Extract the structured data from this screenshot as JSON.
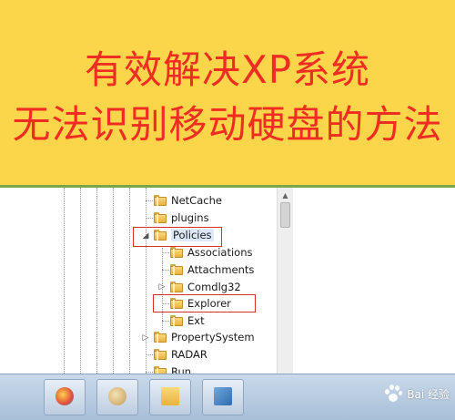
{
  "banner": {
    "line1": "有效解决XP系统",
    "line2": "无法识别移动硬盘的方法",
    "background": "#fbd54a",
    "text_color": "#ef2d23"
  },
  "tree": {
    "items": [
      {
        "label": "NetCache",
        "expander": "none",
        "icon": "folder-icon"
      },
      {
        "label": "plugins",
        "expander": "none",
        "icon": "folder-icon"
      },
      {
        "label": "Policies",
        "expander": "expanded",
        "icon": "folder-icon",
        "highlighted": true
      },
      {
        "label": "Associations",
        "expander": "none",
        "icon": "folder-icon"
      },
      {
        "label": "Attachments",
        "expander": "none",
        "icon": "folder-icon"
      },
      {
        "label": "Comdlg32",
        "expander": "collapsed",
        "icon": "folder-icon"
      },
      {
        "label": "Explorer",
        "expander": "none",
        "icon": "folder-icon",
        "highlighted": true
      },
      {
        "label": "Ext",
        "expander": "none",
        "icon": "folder-icon"
      },
      {
        "label": "PropertySystem",
        "expander": "collapsed",
        "icon": "folder-icon"
      },
      {
        "label": "RADAR",
        "expander": "none",
        "icon": "folder-icon"
      },
      {
        "label": "Run",
        "expander": "none",
        "icon": "folder-icon"
      }
    ],
    "highlight_color": "#d9302a"
  },
  "watermark": {
    "text": "Bai 经验",
    "icon": "baidu-paw-icon"
  }
}
